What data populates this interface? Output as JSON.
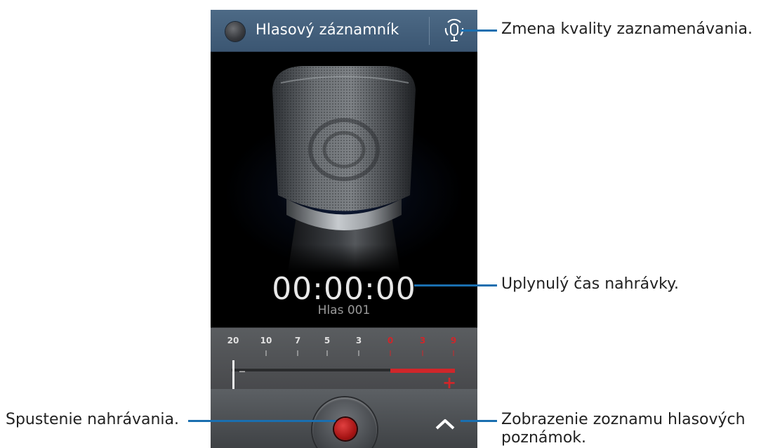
{
  "app": {
    "title": "Hlasový záznamník",
    "timer": "00:00:00",
    "file_name": "Hlas 001"
  },
  "level_meter": {
    "scale": [
      "20",
      "10",
      "7",
      "5",
      "3",
      "0",
      "3",
      "9"
    ],
    "minus_label": "–",
    "plus_label": "+",
    "red_color": "#d0262a"
  },
  "icons": {
    "quality": "microphone-quality-icon",
    "record": "record-icon",
    "list": "chevron-up-icon"
  },
  "callouts": {
    "quality": "Zmena kvality zaznamenávania.",
    "elapsed": "Uplynulý čas nahrávky.",
    "record": "Spustenie nahrávania.",
    "list_line1": "Zobrazenie zoznamu hlasových",
    "list_line2": "poznámok."
  },
  "colors": {
    "callout_line": "#1a6fb0",
    "action_bar": "#43607c"
  }
}
